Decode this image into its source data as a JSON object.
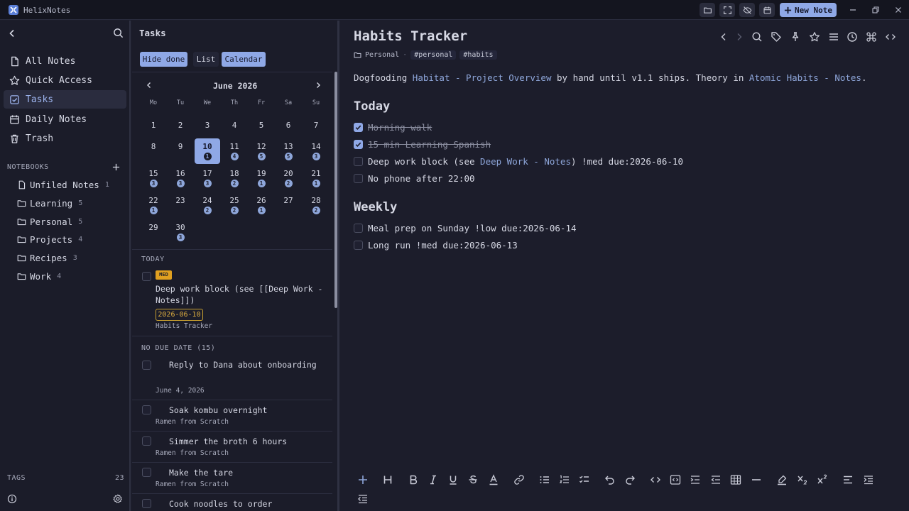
{
  "app": {
    "title": "HelixNotes",
    "new_note_label": "New Note"
  },
  "sidebar": {
    "nav": [
      {
        "label": "All Notes",
        "icon": "file-icon"
      },
      {
        "label": "Quick Access",
        "icon": "star-icon"
      },
      {
        "label": "Tasks",
        "icon": "checkbox-icon"
      },
      {
        "label": "Daily Notes",
        "icon": "calendar-icon"
      },
      {
        "label": "Trash",
        "icon": "trash-icon"
      }
    ],
    "notebooks_title": "NOTEBOOKS",
    "notebooks": [
      {
        "label": "Unfiled Notes",
        "count": "1"
      },
      {
        "label": "Learning",
        "count": "5"
      },
      {
        "label": "Personal",
        "count": "5"
      },
      {
        "label": "Projects",
        "count": "4"
      },
      {
        "label": "Recipes",
        "count": "3"
      },
      {
        "label": "Work",
        "count": "4"
      }
    ],
    "tags_title": "TAGS",
    "tags_count": "23"
  },
  "tasks": {
    "title": "Tasks",
    "filters": {
      "hide_done": "Hide done",
      "list": "List",
      "calendar": "Calendar"
    },
    "calendar": {
      "month": "June 2026",
      "weekdays": [
        "Mo",
        "Tu",
        "We",
        "Th",
        "Fr",
        "Sa",
        "Su"
      ],
      "days": [
        {
          "n": "1",
          "c": ""
        },
        {
          "n": "2",
          "c": ""
        },
        {
          "n": "3",
          "c": ""
        },
        {
          "n": "4",
          "c": ""
        },
        {
          "n": "5",
          "c": ""
        },
        {
          "n": "6",
          "c": ""
        },
        {
          "n": "7",
          "c": ""
        },
        {
          "n": "8",
          "c": ""
        },
        {
          "n": "9",
          "c": ""
        },
        {
          "n": "10",
          "c": "1"
        },
        {
          "n": "11",
          "c": "4"
        },
        {
          "n": "12",
          "c": "5"
        },
        {
          "n": "13",
          "c": "5"
        },
        {
          "n": "14",
          "c": "3"
        },
        {
          "n": "15",
          "c": "3"
        },
        {
          "n": "16",
          "c": "3"
        },
        {
          "n": "17",
          "c": "3"
        },
        {
          "n": "18",
          "c": "2"
        },
        {
          "n": "19",
          "c": "1"
        },
        {
          "n": "20",
          "c": "2"
        },
        {
          "n": "21",
          "c": "1"
        },
        {
          "n": "22",
          "c": "1"
        },
        {
          "n": "23",
          "c": ""
        },
        {
          "n": "24",
          "c": "2"
        },
        {
          "n": "25",
          "c": "2"
        },
        {
          "n": "26",
          "c": "1"
        },
        {
          "n": "27",
          "c": ""
        },
        {
          "n": "28",
          "c": "2"
        },
        {
          "n": "29",
          "c": ""
        },
        {
          "n": "30",
          "c": "3"
        }
      ],
      "selected": "10"
    },
    "today_label": "TODAY",
    "today_task": {
      "priority": "MED",
      "text": "Deep work block (see [[Deep Work - Notes]])",
      "due": "2026-06-10",
      "source": "Habits Tracker"
    },
    "no_due_label": "NO DUE DATE (15)",
    "no_due": [
      {
        "text": "Reply to Dana about onboarding",
        "sub": ""
      },
      {
        "text": "Soak kombu overnight",
        "sub": "Ramen from Scratch"
      },
      {
        "text": "Simmer the broth 6 hours",
        "sub": "Ramen from Scratch"
      },
      {
        "text": "Make the tare",
        "sub": "Ramen from Scratch"
      },
      {
        "text": "Cook noodles to order",
        "sub": ""
      }
    ],
    "date_group": "June 4, 2026"
  },
  "editor": {
    "title": "Habits Tracker",
    "notebook": "Personal",
    "tags": [
      "#personal",
      "#habits"
    ],
    "intro": {
      "pre": "Dogfooding ",
      "link1": "Habitat - Project Overview",
      "mid": " by hand until v1.1 ships. Theory in ",
      "link2": "Atomic Habits - Notes",
      "post": "."
    },
    "today_heading": "Today",
    "today_items": [
      {
        "text": "Morning walk",
        "done": true
      },
      {
        "text": "15 min Learning Spanish",
        "done": true
      }
    ],
    "deep_work": {
      "pre": "Deep work block (see ",
      "link": "Deep Work - Notes",
      "post": ") !med due:2026-06-10"
    },
    "no_phone": "No phone after 22:00",
    "weekly_heading": "Weekly",
    "weekly_items": [
      "Meal prep on Sunday !low due:2026-06-14",
      "Long run !med due:2026-06-13"
    ]
  },
  "colors": {
    "accent": "#8fa8e6",
    "link": "#8ea6da",
    "med": "#e0a020",
    "bg": "#1c1d2b"
  }
}
